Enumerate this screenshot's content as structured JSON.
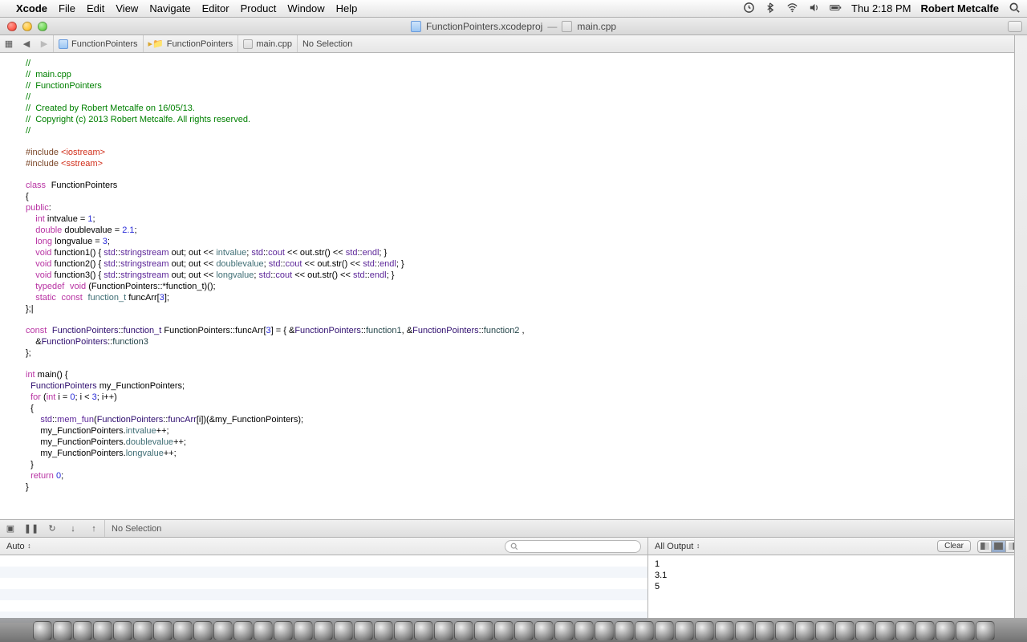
{
  "menubar": {
    "app": "Xcode",
    "items": [
      "File",
      "Edit",
      "View",
      "Navigate",
      "Editor",
      "Product",
      "Window",
      "Help"
    ],
    "time": "Thu 2:18 PM",
    "user": "Robert Metcalfe"
  },
  "window": {
    "project": "FunctionPointers.xcodeproj",
    "separator": "—",
    "file": "main.cpp"
  },
  "jumpbar": {
    "parts": [
      "FunctionPointers",
      "FunctionPointers",
      "main.cpp",
      "No Selection"
    ]
  },
  "debugbar": {
    "status": "No Selection"
  },
  "filterbar": {
    "left_popup": "Auto",
    "right_popup": "All Output",
    "clear": "Clear"
  },
  "console": {
    "lines": [
      "1",
      "3.1",
      "5"
    ]
  },
  "code": {
    "l0": "//",
    "l1": "//  main.cpp",
    "l2": "//  FunctionPointers",
    "l3": "//",
    "l4": "//  Created by Robert Metcalfe on 16/05/13.",
    "l5": "//  Copyright (c) 2013 Robert Metcalfe. All rights reserved.",
    "l6": "//",
    "inc1a": "#include ",
    "inc1b": "<iostream>",
    "inc2a": "#include ",
    "inc2b": "<sstream>",
    "k_class": "class",
    "cls": "FunctionPointers",
    "ob": "{",
    "k_public": "public",
    "colon": ":",
    "pad1": "    ",
    "k_int": "int",
    "intdecl": " intvalue = ",
    "n1": "1",
    "semi": ";",
    "k_double": "double",
    "doubledecl": " doublevalue = ",
    "n21": "2.1",
    "k_long": "long",
    "longdecl": " longvalue = ",
    "n3": "3",
    "k_void": "void",
    "f1a": " function1() { ",
    "std": "std",
    "dc": "::",
    "ss": "stringstream",
    "f1b": " out; out << ",
    "iv": "intvalue",
    "f1c": "; ",
    "cout": "cout",
    "f1d": " << out.str() << ",
    "endl": "endl",
    "f1e": "; }",
    "f2a": " function2() { ",
    "dv": "doublevalue",
    "f3a": " function3() { ",
    "lv": "longvalue",
    "k_typedef": "typedef",
    "tdrest": " (FunctionPointers::*function_t)();",
    "k_static": "static",
    "k_const": "const",
    "function_t": "function_t",
    "arrdecl": " funcArr[",
    "arrdecl2": "];",
    "cb": "};",
    "cursor": "|",
    "fp": "FunctionPointers",
    "func_t": "function_t",
    "defA": " FunctionPointers::funcArr[",
    "defB": "] = { &",
    "fn1": "function1",
    "fn2": "function2",
    "fn3": "function3",
    "comma": ", &",
    "comma2": ", ",
    "defC": " ,",
    "pad2": "    &",
    "defD": " };",
    "cb2": "};",
    "mainA": " main() {",
    "pad3": "  ",
    "mvar": " my_FunctionPointers;",
    "k_for": "for",
    "forA": " (",
    "forB": " i = ",
    "n0": "0",
    "forC": "; i < ",
    "forD": "; i++)",
    "ob2": "  {",
    "pad4": "      ",
    "memfun": "mem_fun",
    "mfA": "(",
    "funcArr": "funcArr",
    "mfB": "[i])(&my_FunctionPointers);",
    "inc_iv": "intvalue",
    "inc_dv": "doublevalue",
    "inc_lv": "longvalue",
    "mfline": "      my_FunctionPointers.",
    "pp": "++;",
    "cb3": "  }",
    "k_return": "return",
    "retA": " ",
    "retB": ";",
    "cb4": "}"
  }
}
